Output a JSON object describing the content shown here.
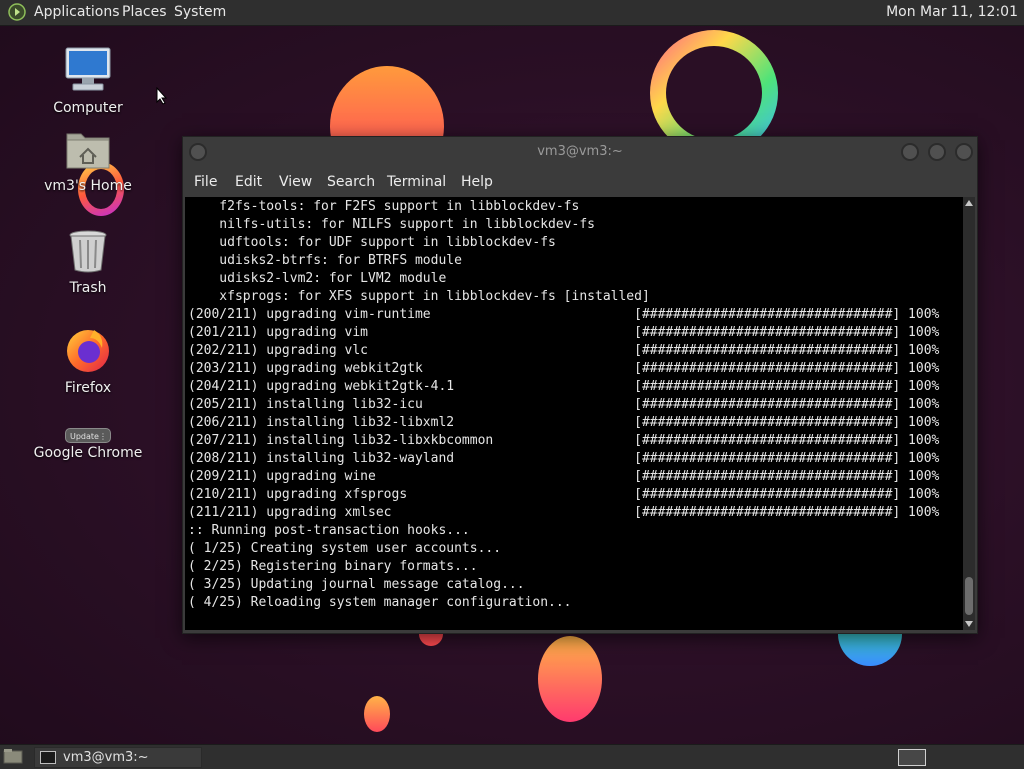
{
  "top_panel": {
    "menu_applications": "Applications",
    "menu_places": "Places",
    "menu_system": "System",
    "clock": "Mon Mar 11, 12:01"
  },
  "desktop": {
    "icons": [
      {
        "label": "Computer"
      },
      {
        "label": "vm3's Home"
      },
      {
        "label": "Trash"
      },
      {
        "label": "Firefox"
      },
      {
        "label": "Google Chrome",
        "badge": "Update"
      }
    ]
  },
  "terminal": {
    "title": "vm3@vm3:~",
    "menu": [
      "File",
      "Edit",
      "View",
      "Search",
      "Terminal",
      "Help"
    ],
    "lines": [
      "    f2fs-tools: for F2FS support in libblockdev-fs",
      "    nilfs-utils: for NILFS support in libblockdev-fs",
      "    udftools: for UDF support in libblockdev-fs",
      "    udisks2-btrfs: for BTRFS module",
      "    udisks2-lvm2: for LVM2 module",
      "    xfsprogs: for XFS support in libblockdev-fs [installed]",
      "(200/211) upgrading vim-runtime                          [################################] 100%",
      "(201/211) upgrading vim                                  [################################] 100%",
      "(202/211) upgrading vlc                                  [################################] 100%",
      "(203/211) upgrading webkit2gtk                           [################################] 100%",
      "(204/211) upgrading webkit2gtk-4.1                       [################################] 100%",
      "(205/211) installing lib32-icu                           [################################] 100%",
      "(206/211) installing lib32-libxml2                       [################################] 100%",
      "(207/211) installing lib32-libxkbcommon                  [################################] 100%",
      "(208/211) installing lib32-wayland                       [################################] 100%",
      "(209/211) upgrading wine                                 [################################] 100%",
      "(210/211) upgrading xfsprogs                             [################################] 100%",
      "(211/211) upgrading xmlsec                               [################################] 100%",
      ":: Running post-transaction hooks...",
      "( 1/25) Creating system user accounts...",
      "( 2/25) Registering binary formats...",
      "( 3/25) Updating journal message catalog...",
      "( 4/25) Reloading system manager configuration..."
    ]
  },
  "taskbar": {
    "task_label": "vm3@vm3:~"
  }
}
